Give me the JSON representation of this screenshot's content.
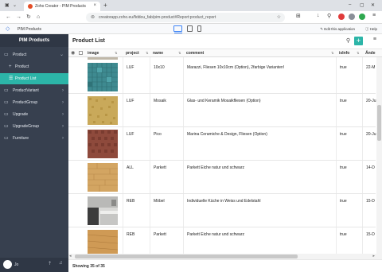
{
  "browser": {
    "tab_title": "Zoho Creator - PIM Products",
    "tab_close": "×",
    "new_tab": "+",
    "url": "creatorapp.zoho.eu/fiddou_fab/pim-product#Report:product_report",
    "window_controls": [
      "–",
      "▢",
      "✕"
    ]
  },
  "app_header": {
    "app_name": "PIM Products",
    "edit_label": "Edit this application",
    "help_label": "Help"
  },
  "sidebar": {
    "title": "PIM Products",
    "items": [
      {
        "label": "Product",
        "icon": "monitor-icon",
        "chevron": "⌄",
        "active": false,
        "sub": false
      },
      {
        "label": "Product",
        "icon": "plus-icon",
        "chevron": "",
        "active": false,
        "sub": true
      },
      {
        "label": "Product List",
        "icon": "list-icon",
        "chevron": "",
        "active": true,
        "sub": true
      },
      {
        "label": "ProductVariant",
        "icon": "monitor-icon",
        "chevron": "›",
        "active": false,
        "sub": false
      },
      {
        "label": "ProductGroup",
        "icon": "monitor-icon",
        "chevron": "›",
        "active": false,
        "sub": false
      },
      {
        "label": "Upgrade",
        "icon": "monitor-icon",
        "chevron": "›",
        "active": false,
        "sub": false
      },
      {
        "label": "UpgradeGroup",
        "icon": "monitor-icon",
        "chevron": "›",
        "active": false,
        "sub": false
      },
      {
        "label": "Furniture",
        "icon": "monitor-icon",
        "chevron": "›",
        "active": false,
        "sub": false
      }
    ],
    "user": "Jo"
  },
  "main": {
    "title": "Product List",
    "columns": {
      "image": "image",
      "project": "project",
      "name": "name",
      "comment": "comment",
      "isinfo": "isInfo",
      "aende": "Ände"
    },
    "rows": [
      {
        "project": "LUF",
        "name": "10x10",
        "comment": "Marazzi, Fliesen 10x10cm (Option), 2farbige Varianten!",
        "isinfo": "true",
        "aende": "22-M",
        "thumb": "teal-tiles"
      },
      {
        "project": "LUF",
        "name": "Mosaik",
        "comment": "Glas- und Keramik Mosaikfliesen (Option)",
        "isinfo": "true",
        "aende": "20-Ju",
        "thumb": "yellow-mosaic"
      },
      {
        "project": "LUF",
        "name": "Pico",
        "comment": "Marina Ceramiche & Design, Fliesen (Option)",
        "isinfo": "true",
        "aende": "20-Ju",
        "thumb": "red-mosaic"
      },
      {
        "project": "ALL",
        "name": "Parkett",
        "comment": "Parkett Eiche natur und schwarz",
        "isinfo": "true",
        "aende": "14-D",
        "thumb": "oak-parquet"
      },
      {
        "project": "REB",
        "name": "Möbel",
        "comment": "Individuelle Küche in Weiss und Edelstahl",
        "isinfo": "true",
        "aende": "15-D",
        "thumb": "kitchen"
      },
      {
        "project": "REB",
        "name": "Parkett",
        "comment": "Parkett Eiche natur und schwarz",
        "isinfo": "true",
        "aende": "15-D",
        "thumb": "oak-parquet-2"
      }
    ],
    "footer": "Showing 35 of 35"
  }
}
